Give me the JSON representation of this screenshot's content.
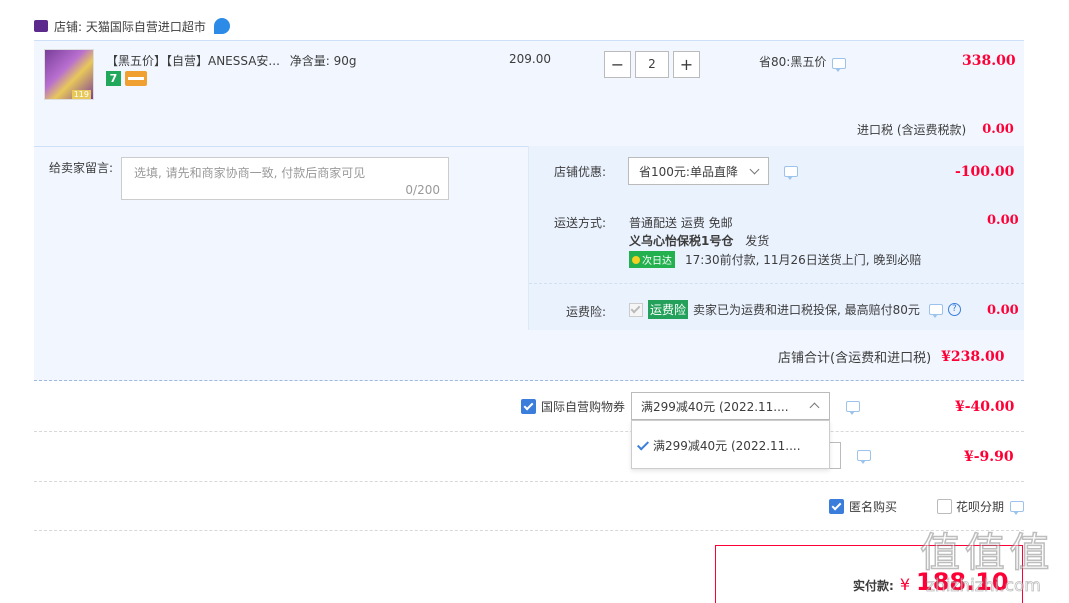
{
  "shop": {
    "label": "店铺: 天猫国际自营进口超市"
  },
  "item": {
    "title": "【黑五价】【自营】ANESSA安...",
    "spec": "净含量: 90g",
    "thumb_price": "119",
    "badge_7": "7",
    "price": "209.00",
    "qty": "2",
    "minus": "−",
    "plus": "+",
    "promo": "省80:黑五价",
    "total": "338.00"
  },
  "tax": {
    "label": "进口税 (含运费税款)",
    "value": "0.00"
  },
  "message": {
    "label": "给卖家留言:",
    "placeholder": "选填, 请先和商家协商一致, 付款后商家可见",
    "counter": "0/200"
  },
  "store_discount": {
    "label": "店铺优惠:",
    "selected": "省100元:单品直降",
    "value": "-100.00"
  },
  "shipping": {
    "label": "运送方式:",
    "method": "普通配送 运费 免邮",
    "warehouse": "义乌心怡保税1号仓",
    "dispatch": "发货",
    "tag": "次日达",
    "note": "17:30前付款, 11月26日送货上门, 晚到必赔",
    "value": "0.00"
  },
  "insurance": {
    "label": "运费险:",
    "tag": "运费险",
    "text": "卖家已为运费和进口税投保, 最高赔付80元",
    "value": "0.00"
  },
  "store_total": {
    "label": "店铺合计(含运费和进口税)",
    "value": "¥238.00"
  },
  "coupon": {
    "label": "国际自营购物券",
    "selected": "满299减40元 (2022.11....",
    "value": "¥-40.00",
    "option": "满299减40元 (2022.11...."
  },
  "second_discount": {
    "value": "¥-9.90"
  },
  "anon": {
    "label": "匿名购买",
    "checked": true
  },
  "huabei": {
    "label": "花呗分期",
    "checked": false
  },
  "pay": {
    "label": "实付款:",
    "currency": "¥",
    "amount": "188.10"
  },
  "watermark": "值 值 值",
  "watermark_url": "zhizhizhi.com",
  "colors": {
    "accent": "#ff0036",
    "blue": "#3a7ddb",
    "panel": "#f2f7ff"
  }
}
